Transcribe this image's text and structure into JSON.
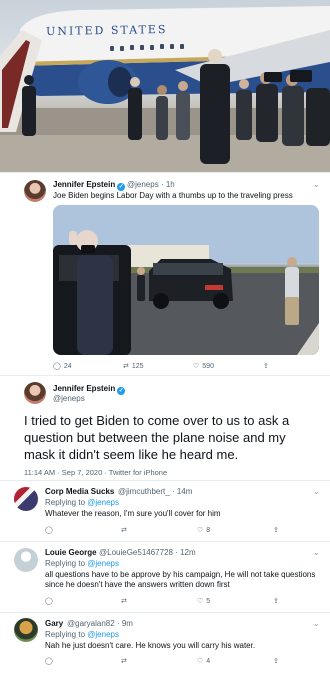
{
  "hero_photo": {
    "fuselage_text": "UNITED STATES"
  },
  "tweet1": {
    "author": "Jennifer Epstein",
    "handle": "@jeneps",
    "time": "· 1h",
    "text": "Joe Biden begins Labor Day with a thumbs up to the traveling press",
    "replies": "24",
    "retweets": "125",
    "likes": "590"
  },
  "tweet2": {
    "author": "Jennifer Epstein",
    "handle": "@jeneps",
    "text": "I tried to get Biden to come over to us to ask a question but between the plane noise and my mask it didn't seem like he heard me.",
    "meta": "11:14 AM · Sep 7, 2020 · Twitter for iPhone"
  },
  "replies": [
    {
      "author": "Corp Media Sucks",
      "handle": "@jimcuthbert_",
      "time": "· 14m",
      "replying_label": "Replying to",
      "replying_to": "@jeneps",
      "text": "Whatever the reason, I'm sure you'll cover for him",
      "likes": "8"
    },
    {
      "author": "Louie George",
      "handle": "@LouieGe51467728",
      "time": "· 12m",
      "replying_label": "Replying to",
      "replying_to": "@jeneps",
      "text": "all questions have to be approve by his campaign, He will not take questions since he doesn't have the answers written down first",
      "likes": "5"
    },
    {
      "author": "Gary",
      "handle": "@garyalan82",
      "time": "· 9m",
      "replying_label": "Replying to",
      "replying_to": "@jeneps",
      "text": "Nah he just doesn't care. He knows you will carry his water.",
      "likes": "4"
    }
  ],
  "colors": {
    "accent": "#1d9bf0",
    "secondary_text": "#536471",
    "plane_blue": "#2b4f8c",
    "separator": "#e6ecf0"
  }
}
